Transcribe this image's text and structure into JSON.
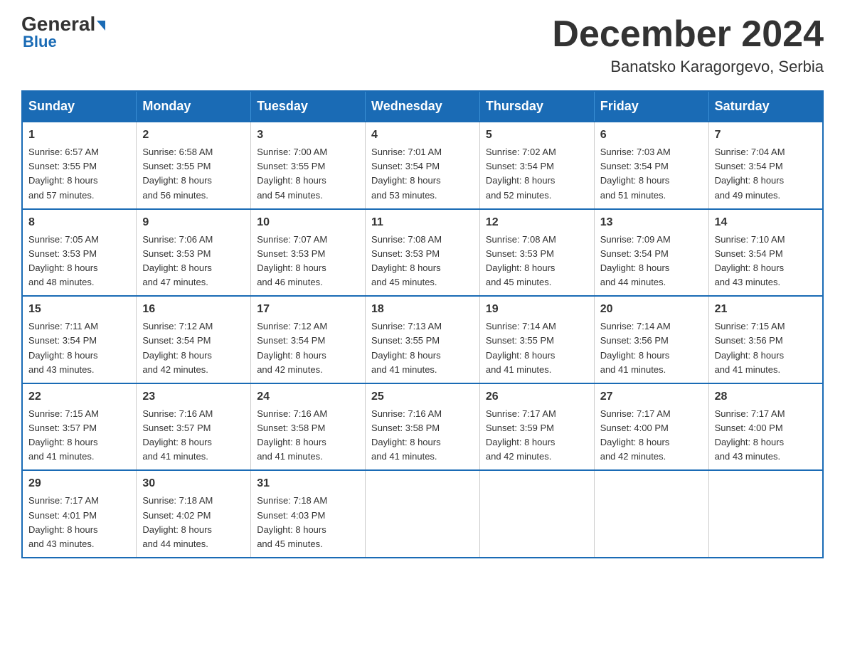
{
  "header": {
    "logo_general": "General",
    "logo_blue": "Blue",
    "month_title": "December 2024",
    "location": "Banatsko Karagorgevo, Serbia"
  },
  "days_of_week": [
    "Sunday",
    "Monday",
    "Tuesday",
    "Wednesday",
    "Thursday",
    "Friday",
    "Saturday"
  ],
  "weeks": [
    [
      {
        "day": "1",
        "sunrise": "6:57 AM",
        "sunset": "3:55 PM",
        "daylight": "8 hours and 57 minutes."
      },
      {
        "day": "2",
        "sunrise": "6:58 AM",
        "sunset": "3:55 PM",
        "daylight": "8 hours and 56 minutes."
      },
      {
        "day": "3",
        "sunrise": "7:00 AM",
        "sunset": "3:55 PM",
        "daylight": "8 hours and 54 minutes."
      },
      {
        "day": "4",
        "sunrise": "7:01 AM",
        "sunset": "3:54 PM",
        "daylight": "8 hours and 53 minutes."
      },
      {
        "day": "5",
        "sunrise": "7:02 AM",
        "sunset": "3:54 PM",
        "daylight": "8 hours and 52 minutes."
      },
      {
        "day": "6",
        "sunrise": "7:03 AM",
        "sunset": "3:54 PM",
        "daylight": "8 hours and 51 minutes."
      },
      {
        "day": "7",
        "sunrise": "7:04 AM",
        "sunset": "3:54 PM",
        "daylight": "8 hours and 49 minutes."
      }
    ],
    [
      {
        "day": "8",
        "sunrise": "7:05 AM",
        "sunset": "3:53 PM",
        "daylight": "8 hours and 48 minutes."
      },
      {
        "day": "9",
        "sunrise": "7:06 AM",
        "sunset": "3:53 PM",
        "daylight": "8 hours and 47 minutes."
      },
      {
        "day": "10",
        "sunrise": "7:07 AM",
        "sunset": "3:53 PM",
        "daylight": "8 hours and 46 minutes."
      },
      {
        "day": "11",
        "sunrise": "7:08 AM",
        "sunset": "3:53 PM",
        "daylight": "8 hours and 45 minutes."
      },
      {
        "day": "12",
        "sunrise": "7:08 AM",
        "sunset": "3:53 PM",
        "daylight": "8 hours and 45 minutes."
      },
      {
        "day": "13",
        "sunrise": "7:09 AM",
        "sunset": "3:54 PM",
        "daylight": "8 hours and 44 minutes."
      },
      {
        "day": "14",
        "sunrise": "7:10 AM",
        "sunset": "3:54 PM",
        "daylight": "8 hours and 43 minutes."
      }
    ],
    [
      {
        "day": "15",
        "sunrise": "7:11 AM",
        "sunset": "3:54 PM",
        "daylight": "8 hours and 43 minutes."
      },
      {
        "day": "16",
        "sunrise": "7:12 AM",
        "sunset": "3:54 PM",
        "daylight": "8 hours and 42 minutes."
      },
      {
        "day": "17",
        "sunrise": "7:12 AM",
        "sunset": "3:54 PM",
        "daylight": "8 hours and 42 minutes."
      },
      {
        "day": "18",
        "sunrise": "7:13 AM",
        "sunset": "3:55 PM",
        "daylight": "8 hours and 41 minutes."
      },
      {
        "day": "19",
        "sunrise": "7:14 AM",
        "sunset": "3:55 PM",
        "daylight": "8 hours and 41 minutes."
      },
      {
        "day": "20",
        "sunrise": "7:14 AM",
        "sunset": "3:56 PM",
        "daylight": "8 hours and 41 minutes."
      },
      {
        "day": "21",
        "sunrise": "7:15 AM",
        "sunset": "3:56 PM",
        "daylight": "8 hours and 41 minutes."
      }
    ],
    [
      {
        "day": "22",
        "sunrise": "7:15 AM",
        "sunset": "3:57 PM",
        "daylight": "8 hours and 41 minutes."
      },
      {
        "day": "23",
        "sunrise": "7:16 AM",
        "sunset": "3:57 PM",
        "daylight": "8 hours and 41 minutes."
      },
      {
        "day": "24",
        "sunrise": "7:16 AM",
        "sunset": "3:58 PM",
        "daylight": "8 hours and 41 minutes."
      },
      {
        "day": "25",
        "sunrise": "7:16 AM",
        "sunset": "3:58 PM",
        "daylight": "8 hours and 41 minutes."
      },
      {
        "day": "26",
        "sunrise": "7:17 AM",
        "sunset": "3:59 PM",
        "daylight": "8 hours and 42 minutes."
      },
      {
        "day": "27",
        "sunrise": "7:17 AM",
        "sunset": "4:00 PM",
        "daylight": "8 hours and 42 minutes."
      },
      {
        "day": "28",
        "sunrise": "7:17 AM",
        "sunset": "4:00 PM",
        "daylight": "8 hours and 43 minutes."
      }
    ],
    [
      {
        "day": "29",
        "sunrise": "7:17 AM",
        "sunset": "4:01 PM",
        "daylight": "8 hours and 43 minutes."
      },
      {
        "day": "30",
        "sunrise": "7:18 AM",
        "sunset": "4:02 PM",
        "daylight": "8 hours and 44 minutes."
      },
      {
        "day": "31",
        "sunrise": "7:18 AM",
        "sunset": "4:03 PM",
        "daylight": "8 hours and 45 minutes."
      },
      null,
      null,
      null,
      null
    ]
  ],
  "labels": {
    "sunrise": "Sunrise: ",
    "sunset": "Sunset: ",
    "daylight": "Daylight: "
  }
}
